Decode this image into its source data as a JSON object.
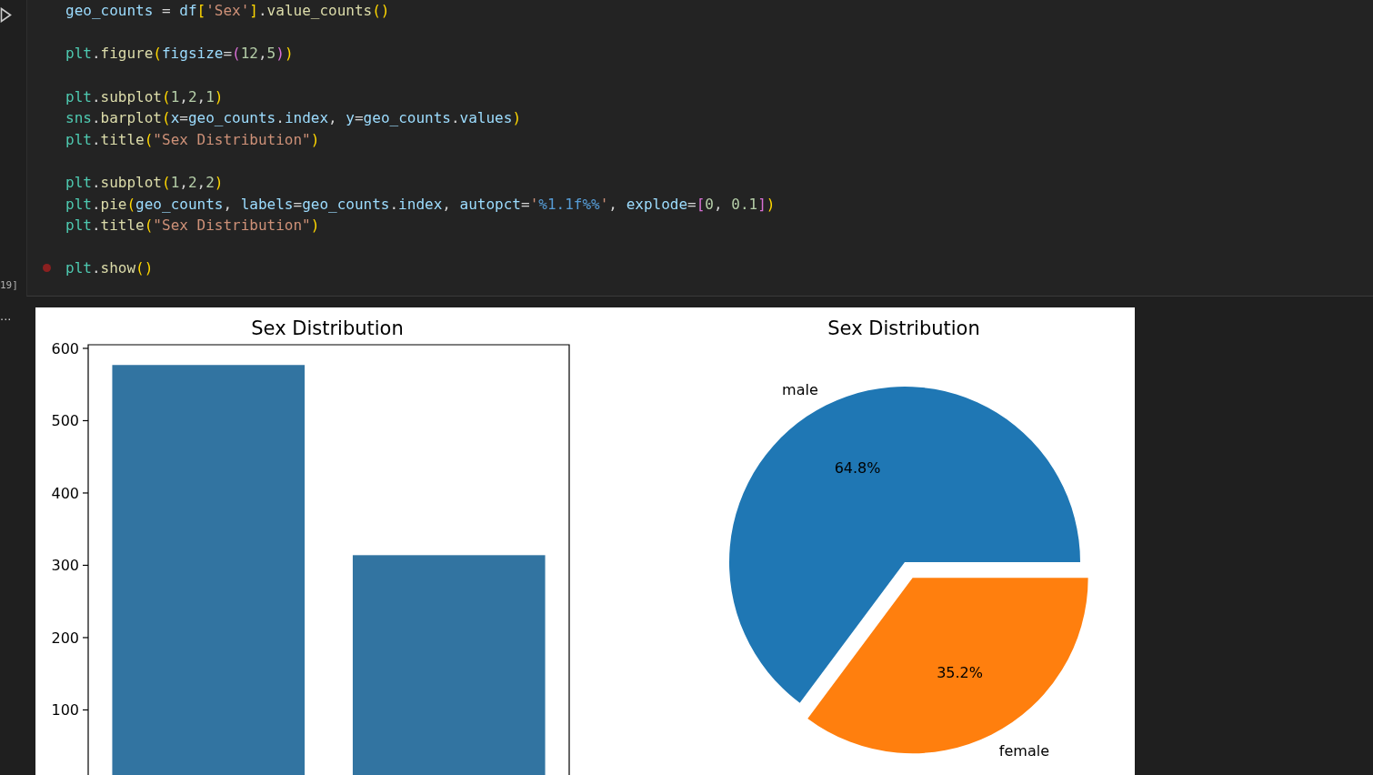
{
  "cell": {
    "execution_count": "19]",
    "output_marker": "...",
    "lines": [
      {
        "gap_before": false,
        "breakpoint": false,
        "text": "geo_counts = df['Sex'].value_counts()"
      },
      {
        "gap_before": true,
        "breakpoint": false,
        "text": "plt.figure(figsize=(12,5))"
      },
      {
        "gap_before": true,
        "breakpoint": false,
        "text": "plt.subplot(1,2,1)"
      },
      {
        "gap_before": false,
        "breakpoint": false,
        "text": "sns.barplot(x=geo_counts.index, y=geo_counts.values)"
      },
      {
        "gap_before": false,
        "breakpoint": false,
        "text": "plt.title(\"Sex Distribution\")"
      },
      {
        "gap_before": true,
        "breakpoint": false,
        "text": "plt.subplot(1,2,2)"
      },
      {
        "gap_before": false,
        "breakpoint": false,
        "text": "plt.pie(geo_counts, labels=geo_counts.index, autopct='%1.1f%%', explode=[0, 0.1])"
      },
      {
        "gap_before": false,
        "breakpoint": false,
        "text": "plt.title(\"Sex Distribution\")"
      },
      {
        "gap_before": true,
        "breakpoint": true,
        "text": "plt.show()"
      }
    ]
  },
  "output": {
    "bar_chart": {
      "chart_data": {
        "type": "bar",
        "title": "Sex Distribution",
        "series": [
          {
            "color": "#3274a1",
            "values": [
              577,
              314
            ]
          }
        ],
        "ylim": [
          10,
          605
        ],
        "yticks": [
          100,
          200,
          300,
          400,
          500,
          600
        ]
      }
    },
    "pie_chart": {
      "chart_data": {
        "type": "pie",
        "title": "Sex Distribution",
        "categories": [
          "male",
          "female"
        ],
        "values": [
          64.8,
          35.2
        ],
        "value_labels": [
          "64.8%",
          "35.2%"
        ]
      }
    }
  }
}
